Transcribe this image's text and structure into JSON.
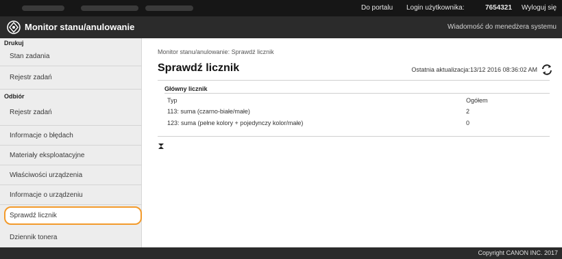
{
  "topbar": {
    "portal_link": "Do portalu",
    "login_label": "Login użytkownika:",
    "user_id": "7654321",
    "logout_link": "Wyloguj się"
  },
  "header": {
    "title": "Monitor stanu/anulowanie",
    "message_link": "Wiadomość do menedżera systemu",
    "logo_icon": "canon-rui-logo-icon"
  },
  "sidebar": {
    "sections": [
      {
        "label": "Drukuj"
      },
      {
        "label": "Odbiór"
      }
    ],
    "items": [
      {
        "label": "Stan zadania"
      },
      {
        "label": "Rejestr zadań"
      },
      {
        "label": "Rejestr zadań"
      },
      {
        "label": "Informacje o błędach"
      },
      {
        "label": "Materiały eksploatacyjne"
      },
      {
        "label": "Właściwości urządzenia"
      },
      {
        "label": "Informacje o urządzeniu"
      },
      {
        "label": "Sprawdź licznik"
      },
      {
        "label": "Dziennik tonera"
      }
    ],
    "active_item": "Sprawdź licznik",
    "highlight_color": "#f39a2a"
  },
  "main": {
    "breadcrumb": "Monitor stanu/anulowanie: Sprawdź licznik",
    "page_title": "Sprawdź licznik",
    "last_updated": "Ostatnia aktualizacja:13/12 2016 08:36:02 AM",
    "section_title": "Główny licznik",
    "table": {
      "headers": [
        "Typ",
        "Ogółem"
      ],
      "rows": [
        [
          "113: suma (czarno-białe/małe)",
          "2"
        ],
        [
          "123: suma (pełne kolory + pojedynczy kolor/małe)",
          "0"
        ]
      ]
    }
  },
  "footer": {
    "copyright": "Copyright CANON INC. 2017"
  }
}
